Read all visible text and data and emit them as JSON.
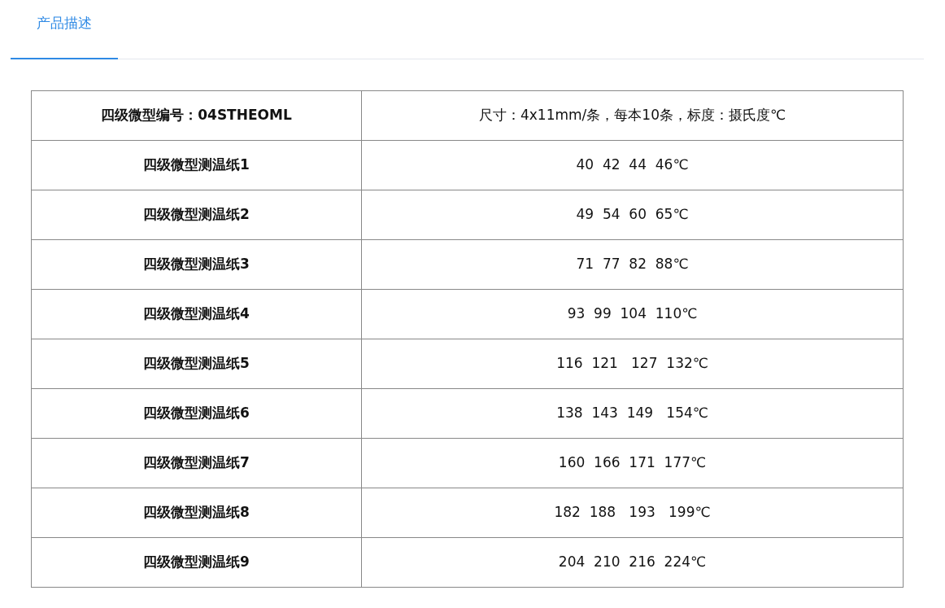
{
  "tabs": [
    {
      "label": "产品描述",
      "selected": true
    }
  ],
  "table": {
    "rows": [
      {
        "cells": [
          "四级微型编号：04STHEOML",
          "尺寸：4x11mm/条，每本10条，标度：摄氏度℃"
        ]
      },
      {
        "cells": [
          "四级微型测温纸1",
          "40  42  44  46℃"
        ]
      },
      {
        "cells": [
          "四级微型测温纸2",
          "49  54  60  65℃"
        ]
      },
      {
        "cells": [
          "四级微型测温纸3",
          "71  77  82  88℃"
        ]
      },
      {
        "cells": [
          "四级微型测温纸4",
          "93  99  104  110℃"
        ]
      },
      {
        "cells": [
          "四级微型测温纸5",
          "116  121   127  132℃"
        ]
      },
      {
        "cells": [
          "四级微型测温纸6",
          "138  143  149   154℃"
        ]
      },
      {
        "cells": [
          "四级微型测温纸7",
          "160  166  171  177℃"
        ]
      },
      {
        "cells": [
          "四级微型测温纸8",
          "182  188   193   199℃"
        ]
      },
      {
        "cells": [
          "四级微型测温纸9",
          "204  210  216  224℃"
        ]
      }
    ]
  }
}
